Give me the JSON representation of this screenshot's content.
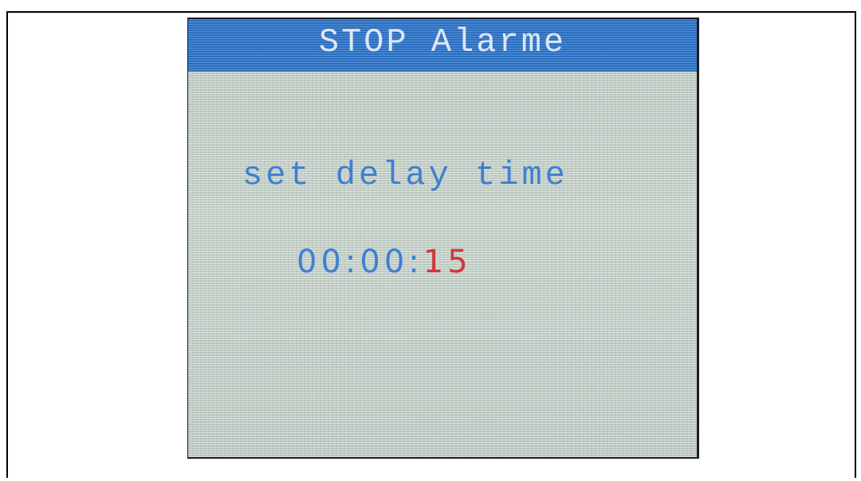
{
  "screen": {
    "title": "STOP Alarme",
    "prompt": "set delay time",
    "time": {
      "hours": "00",
      "minutes": "00",
      "seconds": "15",
      "separator": ":"
    }
  },
  "colors": {
    "title_bar": "#2f77cf",
    "screen_background": "#c8d4cb",
    "text_blue": "#3f7fd0",
    "selected_value_red": "#cf3838"
  }
}
